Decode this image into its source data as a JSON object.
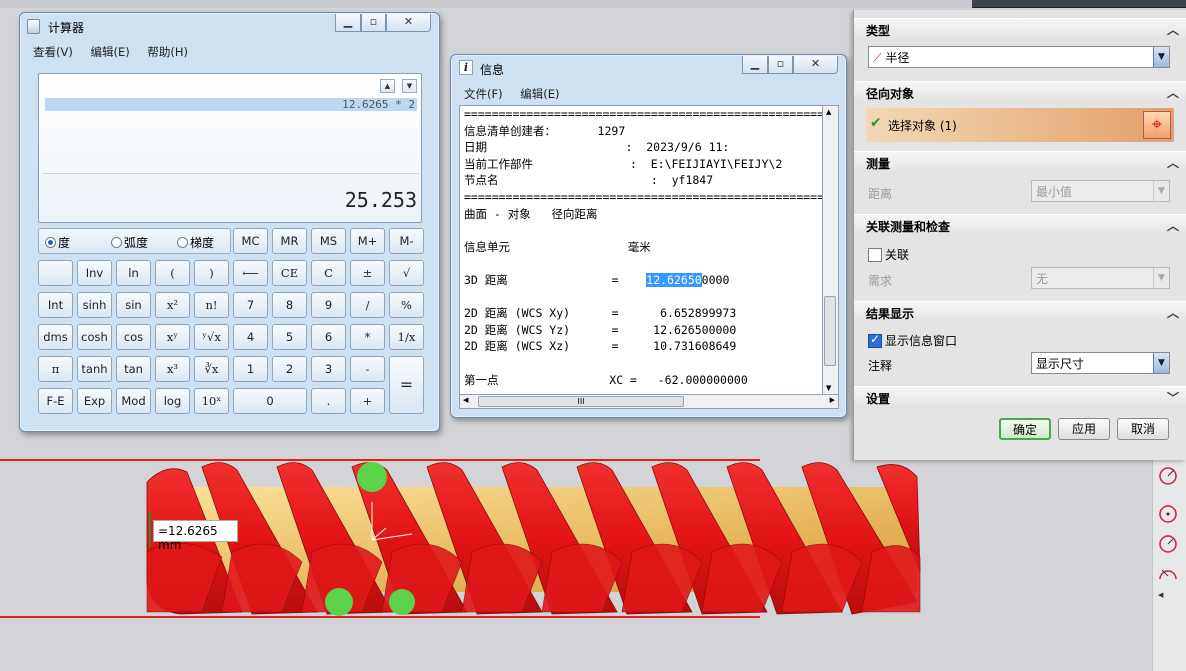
{
  "calculator": {
    "title": "计算器",
    "menu": [
      "查看(V)",
      "编辑(E)",
      "帮助(H)"
    ],
    "expression": "12.6265 * 2",
    "result": "25.253",
    "angle_modes": [
      "度",
      "弧度",
      "梯度"
    ],
    "selected_mode": "度",
    "buttons": {
      "mc": "MC",
      "mr": "MR",
      "ms": "MS",
      "mplus": "M+",
      "mminus": "M-",
      "inv": "Inv",
      "ln": "ln",
      "lparen": "(",
      "rparen": ")",
      "back": "⟵",
      "ce": "CE",
      "c": "C",
      "pm": "±",
      "sqrt": "√",
      "int": "Int",
      "sinh": "sinh",
      "sin": "sin",
      "x2": "x²",
      "fact": "n!",
      "d7": "7",
      "d8": "8",
      "d9": "9",
      "div": "/",
      "pct": "%",
      "dms": "dms",
      "cosh": "cosh",
      "cos": "cos",
      "xy": "xʸ",
      "yroot": "ʸ√x",
      "d4": "4",
      "d5": "5",
      "d6": "6",
      "mul": "*",
      "recip": "1/x",
      "pi": "π",
      "tanh": "tanh",
      "tan": "tan",
      "x3": "x³",
      "cbrt": "∛x",
      "d1": "1",
      "d2": "2",
      "d3": "3",
      "sub": "-",
      "eq": "=",
      "fe": "F-E",
      "exp": "Exp",
      "mod": "Mod",
      "log": "log",
      "ten": "10ˣ",
      "d0": "0",
      "dot": ".",
      "add": "+"
    }
  },
  "info": {
    "title": "信息",
    "menu": [
      "文件(F)",
      "编辑(E)"
    ],
    "sep": "=====================================================",
    "creator_label": "信息清单创建者：",
    "creator_value": "1297",
    "date_label": "日期",
    "date_value": ":  2023/9/6 11:",
    "part_label": "当前工作部件",
    "part_value": ":  E:\\FEIJIAYI\\FEIJY\\2",
    "node_label": "节点名",
    "node_value": ":  yf1847",
    "kind": "曲面 - 对象   径向距离",
    "unit_label": "信息单元",
    "unit_value": "毫米",
    "d3_label": "3D 距离",
    "d3_eq": "=",
    "d3_hl": "12.62650",
    "d3_rest": "0000",
    "xy_label": "2D 距离 (WCS Xy)",
    "xy_value": "=      6.652899973",
    "yz_label": "2D 距离 (WCS Yz)",
    "yz_value": "=     12.626500000",
    "xz_label": "2D 距离 (WCS Xz)",
    "xz_value": "=     10.731608649",
    "p1_label": "第一点",
    "p1_value": "XC =   -62.000000000",
    "hscroll": "III"
  },
  "dialog": {
    "type_section": "类型",
    "type_value": "半径",
    "radial_section": "径向对象",
    "select_object": "选择对象 (1)",
    "measure_section": "测量",
    "distance_label": "距离",
    "distance_value": "最小值",
    "assoc_section": "关联测量和检查",
    "assoc_label": "关联",
    "need_label": "需求",
    "need_value": "无",
    "result_section": "结果显示",
    "show_info": "显示信息窗口",
    "note_label": "注释",
    "note_value": "显示尺寸",
    "settings_section": "设置",
    "ok": "确定",
    "apply": "应用",
    "cancel": "取消"
  },
  "viewport": {
    "measure_label": "=12.6265 mm"
  },
  "colors": {
    "screw_red": "#e51a1a",
    "core_yellow": "#f3c46a",
    "marker_green": "#5cd14a",
    "selection": "#3399ff"
  }
}
